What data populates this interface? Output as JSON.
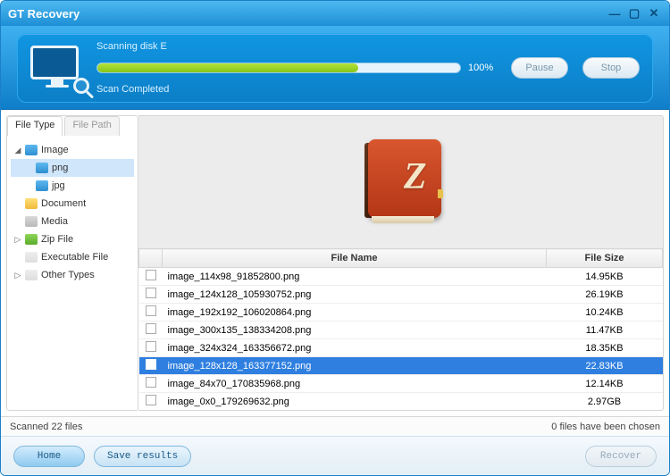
{
  "titlebar": {
    "title": "GT Recovery"
  },
  "header": {
    "scanning_label": "Scanning disk E",
    "percent": "100%",
    "status": "Scan Completed",
    "pause": "Pause",
    "stop": "Stop"
  },
  "tabs": {
    "file_type": "File Type",
    "file_path": "File Path"
  },
  "tree": {
    "image": "Image",
    "png": "png",
    "jpg": "jpg",
    "document": "Document",
    "media": "Media",
    "zip": "Zip File",
    "exe": "Executable File",
    "other": "Other Types"
  },
  "columns": {
    "name": "File Name",
    "size": "File Size"
  },
  "files": [
    {
      "name": "image_114x98_91852800.png",
      "size": "14.95KB"
    },
    {
      "name": "image_124x128_105930752.png",
      "size": "26.19KB"
    },
    {
      "name": "image_192x192_106020864.png",
      "size": "10.24KB"
    },
    {
      "name": "image_300x135_138334208.png",
      "size": "11.47KB"
    },
    {
      "name": "image_324x324_163356672.png",
      "size": "18.35KB"
    },
    {
      "name": "image_128x128_163377152.png",
      "size": "22.83KB"
    },
    {
      "name": "image_84x70_170835968.png",
      "size": "12.14KB"
    },
    {
      "name": "image_0x0_179269632.png",
      "size": "2.97GB"
    }
  ],
  "selected_index": 5,
  "status": {
    "left": "Scanned 22 files",
    "right": "0 files have been chosen"
  },
  "footer": {
    "home": "Home",
    "save": "Save results",
    "recover": "Recover"
  }
}
